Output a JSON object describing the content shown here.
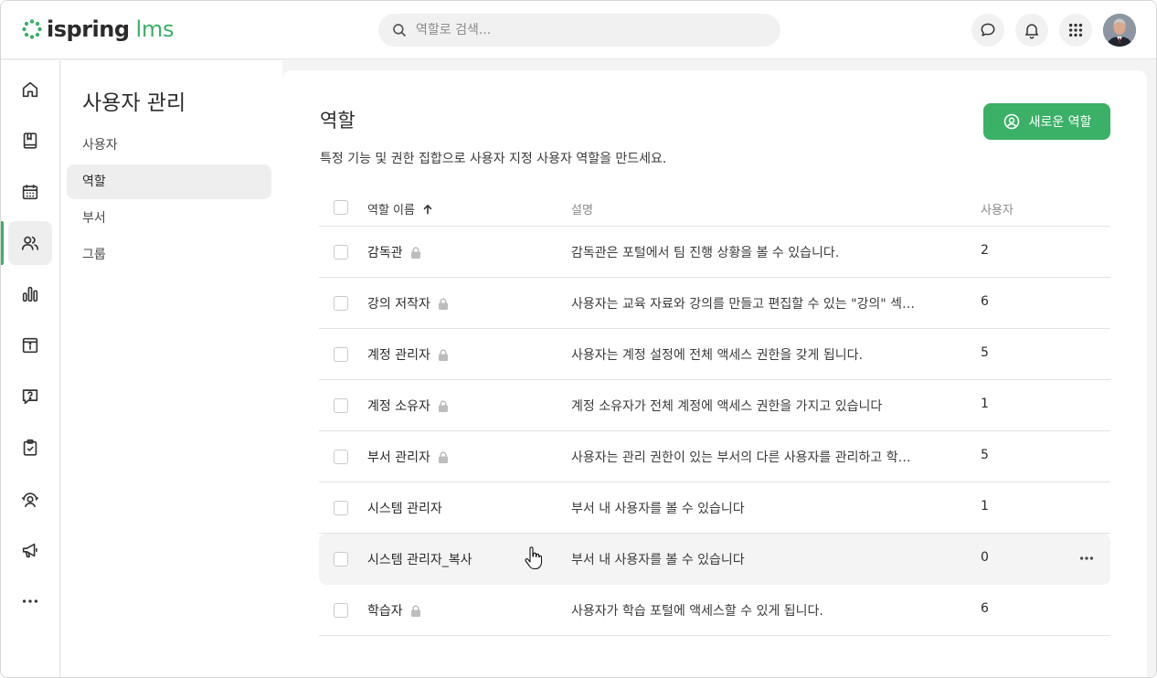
{
  "header": {
    "brand": "ispring",
    "product": "lms",
    "search_placeholder": "역할로 검색..."
  },
  "colors": {
    "accent": "#3bb067",
    "active_bg": "#eeeeee"
  },
  "rail": {
    "icons": [
      "home-icon",
      "book-icon",
      "calendar-icon",
      "users-icon",
      "bar-chart-icon",
      "info-box-icon",
      "question-chat-icon",
      "clipboard-check-icon",
      "support-agent-icon",
      "megaphone-icon",
      "more-icon"
    ],
    "active": "users-icon"
  },
  "subnav": {
    "title": "사용자 관리",
    "items": [
      {
        "label": "사용자"
      },
      {
        "label": "역할"
      },
      {
        "label": "부서"
      },
      {
        "label": "그룹"
      }
    ],
    "active": "역할"
  },
  "page": {
    "title": "역할",
    "description": "특정 기능 및 권한 집합으로 사용자 지정 사용자 역할을 만드세요.",
    "new_role_label": "새로운 역할"
  },
  "table": {
    "columns": {
      "name": "역할 이름",
      "description": "설명",
      "users": "사용자"
    },
    "rows": [
      {
        "name": "감독관",
        "locked": true,
        "description": "감독관은 포털에서 팀 진행 상황을 볼 수 있습니다.",
        "users": "2"
      },
      {
        "name": "강의 저작자",
        "locked": true,
        "description": "사용자는 교육 자료와 강의를 만들고 편집할 수 있는 \"강의\" 섹…",
        "users": "6"
      },
      {
        "name": "계정 관리자",
        "locked": true,
        "description": "사용자는 계정 설정에 전체 액세스 권한을 갖게 됩니다.",
        "users": "5"
      },
      {
        "name": "계정 소유자",
        "locked": true,
        "description": "계정 소유자가 전체 계정에 액세스 권한을 가지고 있습니다",
        "users": "1"
      },
      {
        "name": "부서 관리자",
        "locked": true,
        "description": "사용자는 관리 권한이 있는 부서의 다른 사용자를 관리하고 학…",
        "users": "5"
      },
      {
        "name": "시스템 관리자",
        "locked": false,
        "description": "부서 내 사용자를 볼 수 있습니다",
        "users": "1"
      },
      {
        "name": "시스템 관리자_복사",
        "locked": false,
        "description": "부서 내 사용자를 볼 수 있습니다",
        "users": "0"
      },
      {
        "name": "학습자",
        "locked": true,
        "description": "사용자가 학습 포털에 액세스할 수 있게 됩니다.",
        "users": "6"
      }
    ]
  }
}
